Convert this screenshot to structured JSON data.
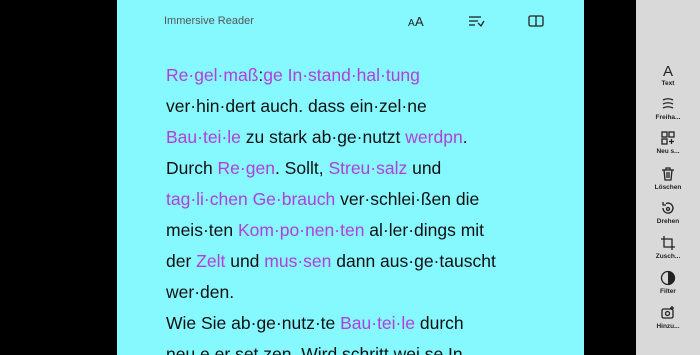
{
  "reader": {
    "title": "Immersive Reader",
    "tools": {
      "text_prefs": "text-preferences-icon",
      "grammar": "grammar-options-icon",
      "read": "reading-preferences-icon"
    },
    "lines": [
      [
        {
          "t": "Re·gel·maß",
          "h": true
        },
        {
          "t": ":"
        },
        {
          "t": "ge In·stand·hal·tung",
          "h": true
        }
      ],
      [
        {
          "t": "ver·hin·dert auch. dass ein·zel·ne"
        }
      ],
      [
        {
          "t": "Bau·tei·le",
          "h": true
        },
        {
          "t": " zu stark ab·ge·nutzt "
        },
        {
          "t": "werdpn",
          "h": true
        },
        {
          "t": "."
        }
      ],
      [
        {
          "t": "Durch "
        },
        {
          "t": "Re·gen",
          "h": true
        },
        {
          "t": ". Sollt, "
        },
        {
          "t": "Streu·salz",
          "h": true
        },
        {
          "t": " und"
        }
      ],
      [
        {
          "t": "tag·li·chen Ge·brauch",
          "h": true
        },
        {
          "t": " ver·schlei·ßen die"
        }
      ],
      [
        {
          "t": "meis·ten "
        },
        {
          "t": "Kom·po·nen·ten",
          "h": true
        },
        {
          "t": " al·ler·dings mit"
        }
      ],
      [
        {
          "t": "der "
        },
        {
          "t": "Zelt",
          "h": true
        },
        {
          "t": " und "
        },
        {
          "t": "mus·sen",
          "h": true
        },
        {
          "t": " dann aus·ge·tauscht"
        }
      ],
      [
        {
          "t": "wer·den."
        }
      ],
      [
        {
          "t": "Wie Sie ab·ge·nutz·te "
        },
        {
          "t": "Bau·tei·le",
          "h": true
        },
        {
          "t": " durch"
        }
      ],
      [
        {
          "t": "neu e er set zen. Wird schritt wei se In"
        }
      ]
    ],
    "highlight_color": "#b040d8",
    "background_color": "#86f8ff"
  },
  "panel": {
    "items": [
      {
        "icon": "text-icon",
        "label": "Text"
      },
      {
        "icon": "freehand-icon",
        "label": "Freiha..."
      },
      {
        "icon": "new-sticker-icon",
        "label": "Neu s..."
      },
      {
        "icon": "trash-icon",
        "label": "Löschen"
      },
      {
        "icon": "rotate-icon",
        "label": "Drehen"
      },
      {
        "icon": "crop-icon",
        "label": "Zusch..."
      },
      {
        "icon": "filter-icon",
        "label": "Filter"
      },
      {
        "icon": "add-photo-icon",
        "label": "Hinzu..."
      }
    ]
  }
}
